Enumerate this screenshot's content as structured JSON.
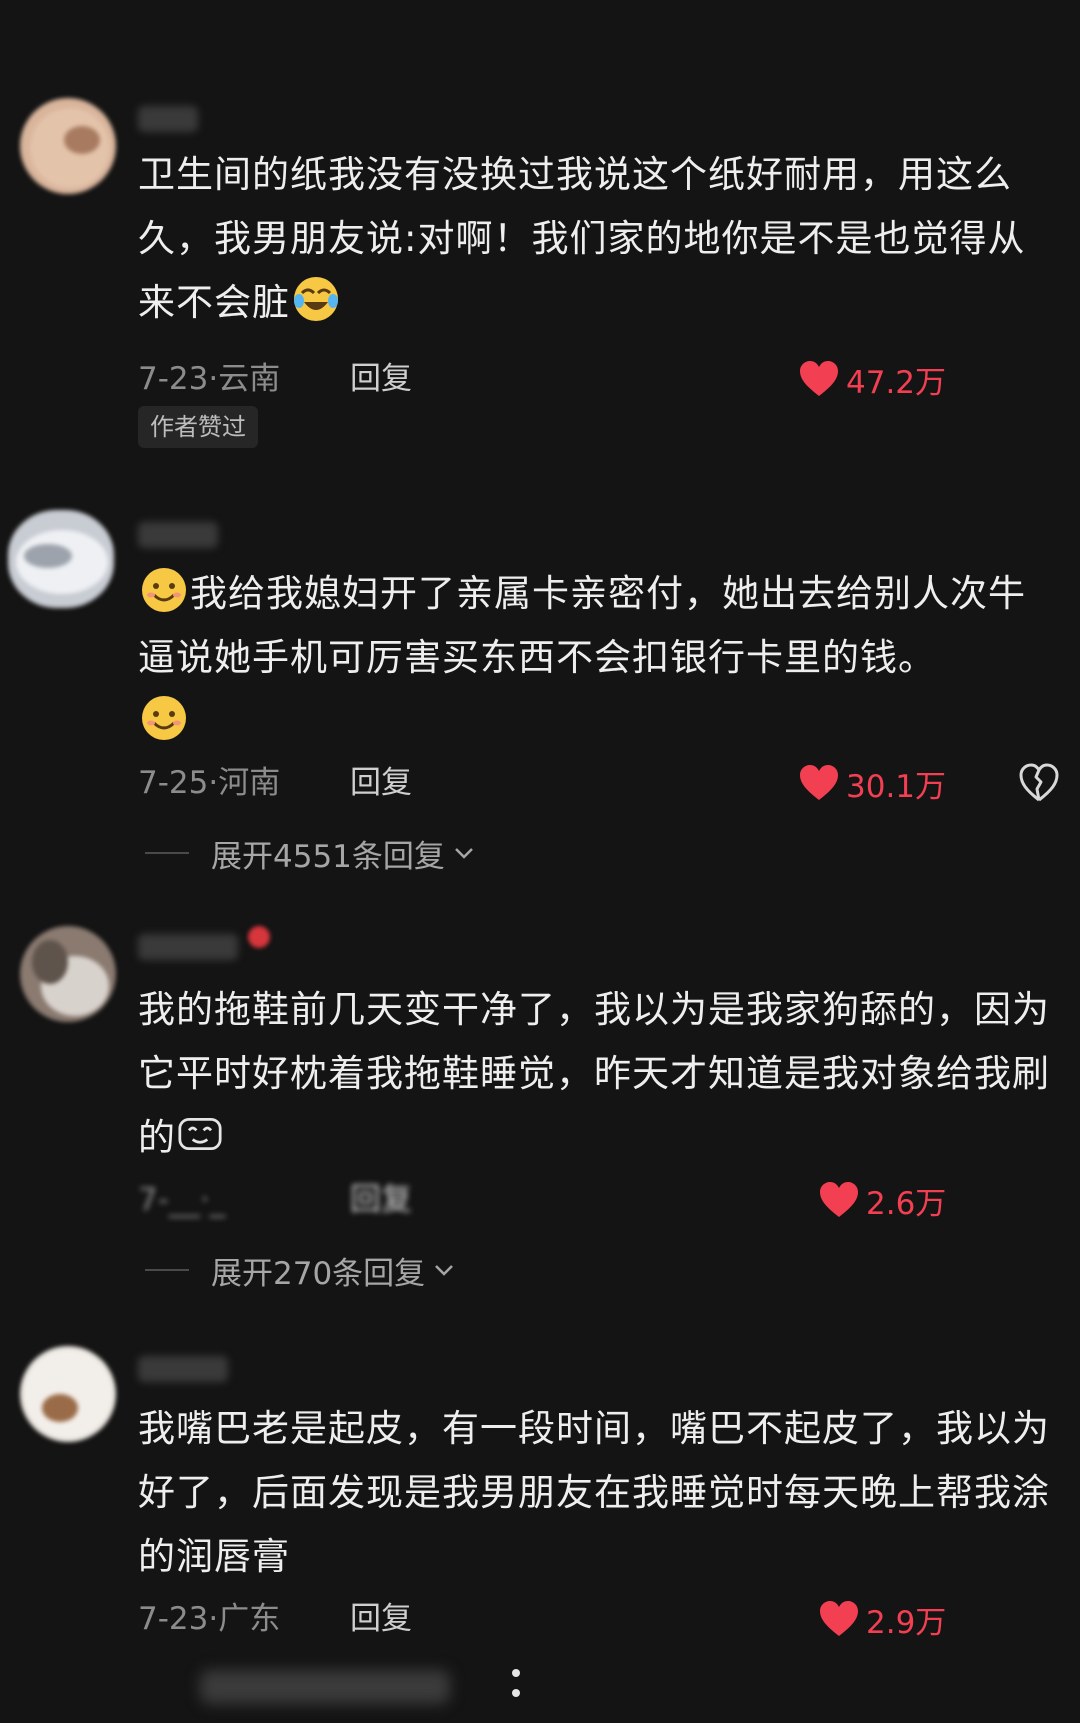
{
  "comments": [
    {
      "text": "卫生间的纸我没有没换过我说这个纸好耐用，用这么久，我男朋友说:对啊！我们家的地你是不是也觉得从来不会脏",
      "emoji_trailing": "crying-laughing-emoji",
      "date_location": "7-23·云南",
      "reply_label": "回复",
      "likes": "47.2万",
      "author_badge": "作者赞过"
    },
    {
      "emoji_leading": "smiling-face-emoji",
      "text": "我给我媳妇开了亲属卡亲密付，她出去给别人次牛逼说她手机可厉害买东西不会扣银行卡里的钱。",
      "emoji_trailing": "smiling-face-emoji",
      "date_location": "7-25·河南",
      "reply_label": "回复",
      "likes": "30.1万",
      "expand_label": "展开4551条回复"
    },
    {
      "text": "我的拖鞋前几天变干净了，我以为是我家狗舔的，因为它平时好枕着我拖鞋睡觉，昨天才知道是我对象给我刷的",
      "emoji_trailing": "expression-emoji",
      "date_location": "7-__·_",
      "reply_label": "回复",
      "likes": "2.6万",
      "expand_label": "展开270条回复"
    },
    {
      "text": "我嘴巴老是起皮，有一段时间，嘴巴不起皮了，我以为好了，后面发现是我男朋友在我睡觉时每天晚上帮我涂的润唇膏",
      "date_location": "7-23·广东",
      "reply_label": "回复",
      "likes": "2.9万"
    }
  ],
  "colors": {
    "background": "#141414",
    "like_red": "#f23f52",
    "meta_gray": "#8c8c8c"
  },
  "icons": [
    "heart-icon",
    "broken-heart-icon",
    "chevron-down-icon",
    "more-icon"
  ]
}
